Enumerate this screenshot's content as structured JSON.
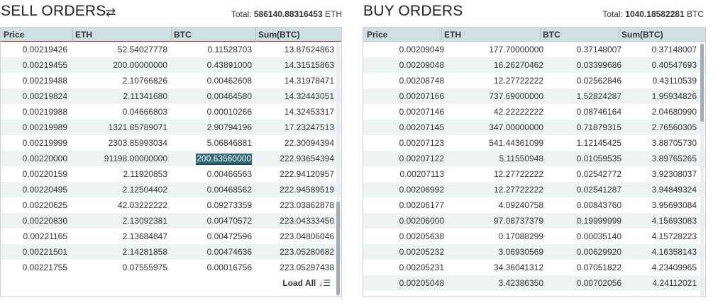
{
  "sell": {
    "title": "SELL ORDERS",
    "swap_icon": "⇄",
    "total_label": "Total:",
    "total_value": "586140.88316453",
    "total_unit": "ETH",
    "headers": [
      "Price",
      "ETH",
      "BTC",
      "Sum(BTC)"
    ],
    "rows": [
      [
        "0.00219426",
        "52.54027778",
        "0.11528703",
        "13.87624863"
      ],
      [
        "0.00219455",
        "200.00000000",
        "0.43891000",
        "14.31515863"
      ],
      [
        "0.00219488",
        "2.10766826",
        "0.00462608",
        "14.31978471"
      ],
      [
        "0.00219824",
        "2.11341680",
        "0.00464580",
        "14.32443051"
      ],
      [
        "0.00219988",
        "0.04666803",
        "0.00010266",
        "14.32453317"
      ],
      [
        "0.00219989",
        "1321.85789071",
        "2.90794196",
        "17.23247513"
      ],
      [
        "0.00219999",
        "2303.85993034",
        "5.06846881",
        "22.30094394"
      ],
      [
        "0.00220000",
        "91198.00000000",
        "200.63560000",
        "222.93654394"
      ],
      [
        "0.00220159",
        "2.11920853",
        "0.00466563",
        "222.94120957"
      ],
      [
        "0.00220495",
        "2.12504402",
        "0.00468562",
        "222.94589519"
      ],
      [
        "0.00220625",
        "42.03222222",
        "0.09273359",
        "223.03862878"
      ],
      [
        "0.00220830",
        "2.13092381",
        "0.00470572",
        "223.04333450"
      ],
      [
        "0.00221165",
        "2.13684847",
        "0.00472596",
        "223.04806046"
      ],
      [
        "0.00221501",
        "2.14281858",
        "0.00474636",
        "223.05280682"
      ],
      [
        "0.00221755",
        "0.07555975",
        "0.00016756",
        "223.05297438"
      ]
    ],
    "highlighted_cell": "200.63560000",
    "load_all_label": "Load All",
    "load_all_icon": "sort-icon"
  },
  "buy": {
    "title": "BUY ORDERS",
    "total_label": "Total:",
    "total_value": "1040.18582281",
    "total_unit": "BTC",
    "headers": [
      "Price",
      "ETH",
      "BTC",
      "Sum(BTC)"
    ],
    "rows": [
      [
        "0.00209049",
        "177.70000000",
        "0.37148007",
        "0.37148007"
      ],
      [
        "0.00209048",
        "16.26270462",
        "0.03399686",
        "0.40547693"
      ],
      [
        "0.00208748",
        "12.27722222",
        "0.02562846",
        "0.43110539"
      ],
      [
        "0.00207166",
        "737.69000000",
        "1.52824287",
        "1.95934826"
      ],
      [
        "0.00207146",
        "42.22222222",
        "0.08746164",
        "2.04680990"
      ],
      [
        "0.00207145",
        "347.00000000",
        "0.71879315",
        "2.76560305"
      ],
      [
        "0.00207123",
        "541.44361099",
        "1.12145425",
        "3.88705730"
      ],
      [
        "0.00207122",
        "5.11550948",
        "0.01059535",
        "3.89765265"
      ],
      [
        "0.00207113",
        "12.27722222",
        "0.02542772",
        "3.92308037"
      ],
      [
        "0.00206992",
        "12.27722222",
        "0.02541287",
        "3.94849324"
      ],
      [
        "0.00206177",
        "4.09240758",
        "0.00843760",
        "3.95693084"
      ],
      [
        "0.00206000",
        "97.08737379",
        "0.19999999",
        "4.15693083"
      ],
      [
        "0.00205638",
        "0.17088299",
        "0.00035140",
        "4.15728223"
      ],
      [
        "0.00205232",
        "3.06930569",
        "0.00629920",
        "4.16358143"
      ],
      [
        "0.00205231",
        "34.36041312",
        "0.07051822",
        "4.23409965"
      ],
      [
        "0.00205048",
        "3.42386350",
        "0.00702056",
        "4.24112021"
      ]
    ]
  },
  "colors": {
    "header_bg": "#cfe0e3",
    "row_alt_bg": "#eef3f4",
    "highlight_bg": "#2e6b76",
    "sell_header_border": "#b04040"
  }
}
